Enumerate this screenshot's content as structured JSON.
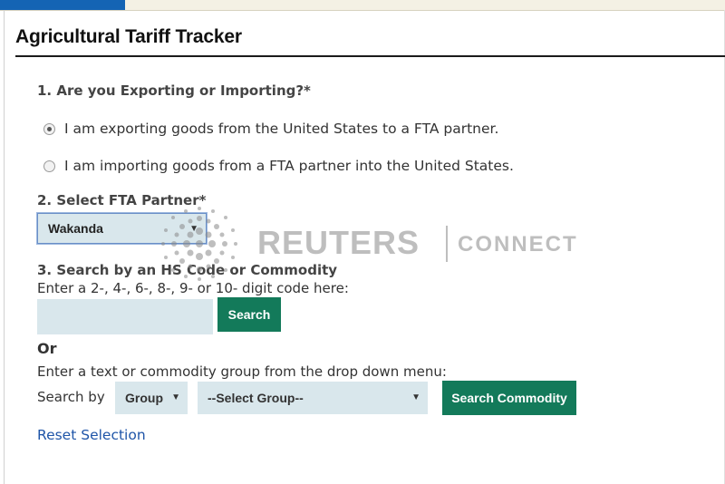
{
  "page": {
    "title": "Agricultural Tariff Tracker"
  },
  "q1": {
    "heading": "1. Are you Exporting or Importing?*",
    "options": [
      {
        "label": "I am exporting goods from the United States to a FTA partner.",
        "checked": true
      },
      {
        "label": "I am importing goods from a FTA partner into the United States.",
        "checked": false
      }
    ]
  },
  "q2": {
    "heading": "2. Select FTA Partner*",
    "selected": "Wakanda"
  },
  "q3": {
    "heading": "3. Search by an HS Code or Commodity",
    "hs_instruction": "Enter a 2-, 4-, 6-, 8-, 9- or 10- digit code here:",
    "hs_value": "",
    "search_label": "Search",
    "or_label": "Or",
    "text_instruction": "Enter a text or commodity group from the drop down menu:",
    "search_by_label": "Search by",
    "search_by_value": "Group",
    "group_value": "--Select Group--",
    "search_commodity_label": "Search Commodity"
  },
  "reset_label": "Reset Selection",
  "watermark": {
    "brand": "REUTERS",
    "product": "CONNECT"
  },
  "colors": {
    "accent_tab": "#1464b4",
    "button_green": "#137a5a",
    "field_bg": "#d9e7ec",
    "link": "#1f55a8"
  },
  "icons": {
    "caret": "caret-down-icon",
    "radio_checked": "radio-checked-icon",
    "radio_unchecked": "radio-unchecked-icon"
  }
}
